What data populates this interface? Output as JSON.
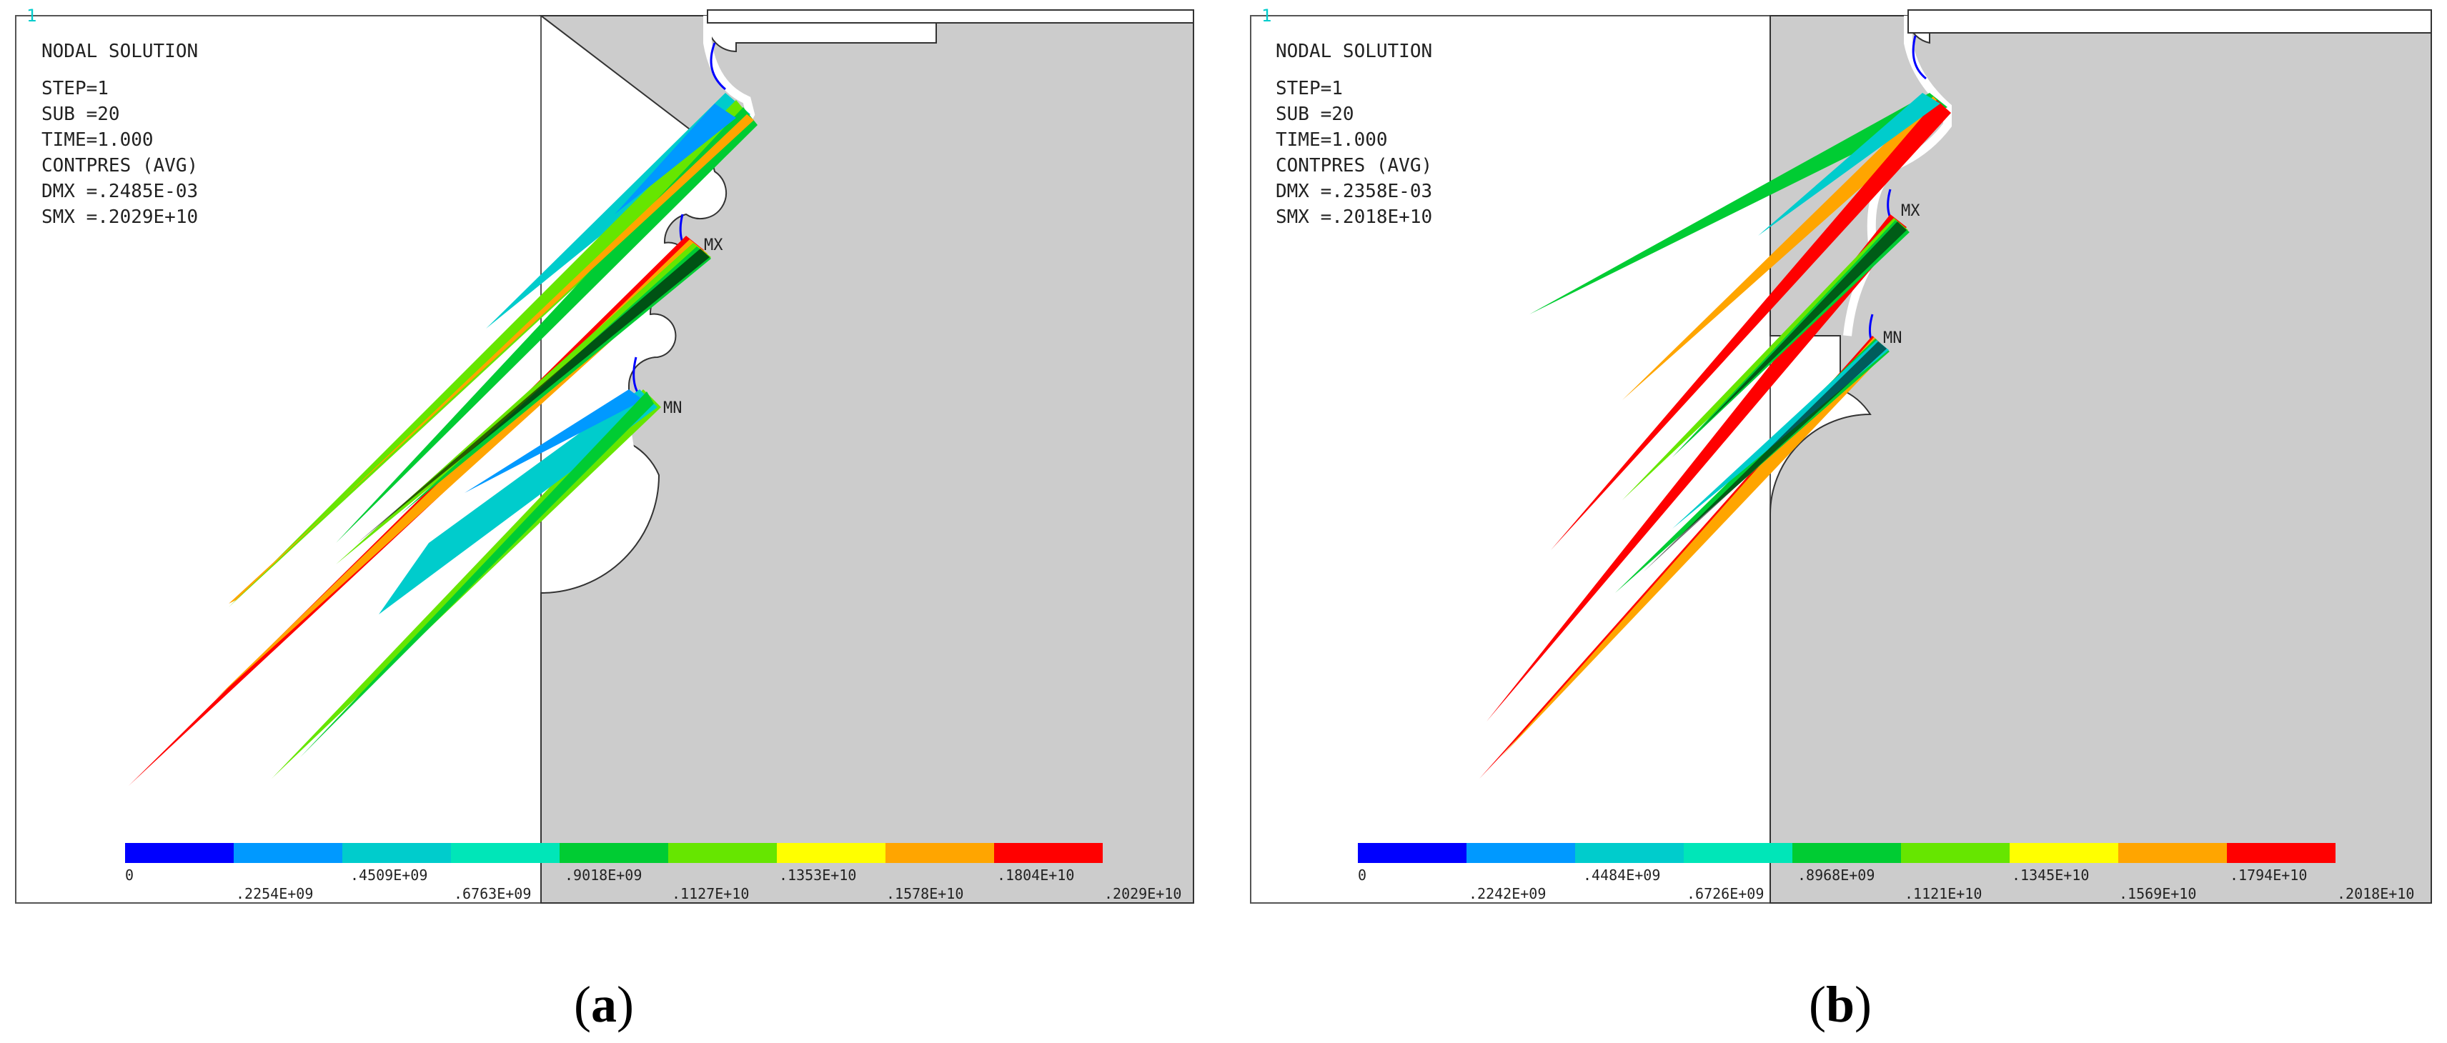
{
  "panels": [
    {
      "id": "a",
      "caption_open": "(",
      "caption_letter": "a",
      "caption_close": ")",
      "corner_mark": "1",
      "info": {
        "title": "NODAL SOLUTION",
        "step": "STEP=1",
        "sub": "SUB =20",
        "time": "TIME=1.000",
        "quantity": "CONTPRES (AVG)",
        "dmx": "DMX =.2485E-03",
        "smx": "SMX =.2029E+10"
      },
      "max_label": "MX",
      "min_label": "MN",
      "legend_top": [
        "0",
        ".4509E+09",
        ".9018E+09",
        ".1353E+10",
        ".1804E+10"
      ],
      "legend_bottom": [
        ".2254E+09",
        ".6763E+09",
        ".1127E+10",
        ".1578E+10",
        ".2029E+10"
      ]
    },
    {
      "id": "b",
      "caption_open": "(",
      "caption_letter": "b",
      "caption_close": ")",
      "corner_mark": "1",
      "info": {
        "title": "NODAL SOLUTION",
        "step": "STEP=1",
        "sub": "SUB =20",
        "time": "TIME=1.000",
        "quantity": "CONTPRES (AVG)",
        "dmx": "DMX =.2358E-03",
        "smx": "SMX =.2018E+10"
      },
      "max_label": "MX",
      "min_label": "MN",
      "legend_top": [
        "0",
        ".4484E+09",
        ".8968E+09",
        ".1345E+10",
        ".1794E+10"
      ],
      "legend_bottom": [
        ".2242E+09",
        ".6726E+09",
        ".1121E+10",
        ".1569E+10",
        ".2018E+10"
      ]
    }
  ],
  "legend_colors": [
    "#0000ff",
    "#0099ff",
    "#00cccc",
    "#00e6b8",
    "#00cc33",
    "#66e600",
    "#ffff00",
    "#ffa500",
    "#ff0000"
  ]
}
